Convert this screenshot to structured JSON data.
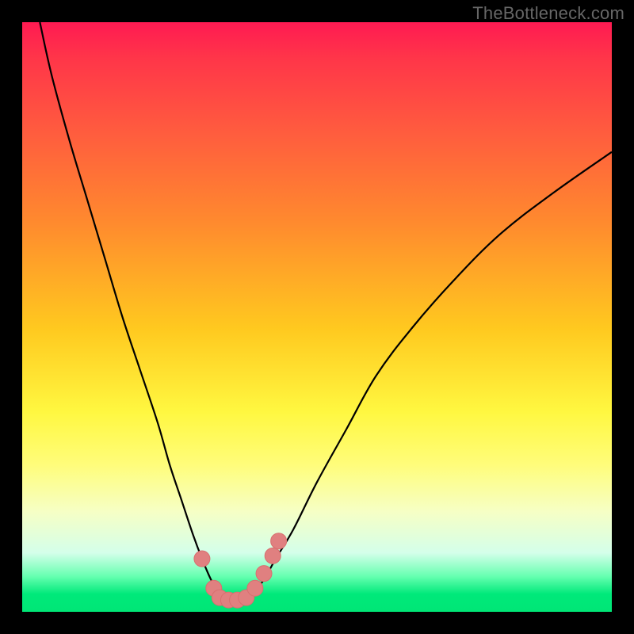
{
  "watermark": "TheBottleneck.com",
  "colors": {
    "frame": "#000000",
    "curve_stroke": "#000000",
    "marker_fill": "#e08080",
    "marker_stroke": "#d86f6f"
  },
  "chart_data": {
    "type": "line",
    "title": "",
    "xlabel": "",
    "ylabel": "",
    "xlim": [
      0,
      100
    ],
    "ylim": [
      0,
      100
    ],
    "grid": false,
    "legend": false,
    "series": [
      {
        "name": "bottleneck-curve",
        "x": [
          3,
          5,
          8,
          11,
          14,
          17,
          20,
          23,
          25,
          27,
          29,
          30.5,
          32,
          33.5,
          35,
          37,
          39,
          41,
          43,
          46,
          50,
          55,
          60,
          66,
          73,
          81,
          90,
          100
        ],
        "y": [
          100,
          91,
          80,
          70,
          60,
          50,
          41,
          32,
          25,
          19,
          13,
          9,
          5.5,
          3,
          2,
          2,
          3,
          5.5,
          9,
          14,
          22,
          31,
          40,
          48,
          56,
          64,
          71,
          78
        ]
      }
    ],
    "markers": [
      {
        "x": 30.5,
        "y": 9
      },
      {
        "x": 32.5,
        "y": 4
      },
      {
        "x": 33.5,
        "y": 2.4
      },
      {
        "x": 35.0,
        "y": 2
      },
      {
        "x": 36.5,
        "y": 2
      },
      {
        "x": 38.0,
        "y": 2.4
      },
      {
        "x": 39.5,
        "y": 4
      },
      {
        "x": 41.0,
        "y": 6.5
      },
      {
        "x": 42.5,
        "y": 9.5
      },
      {
        "x": 43.5,
        "y": 12
      }
    ],
    "marker_radius": 10
  }
}
